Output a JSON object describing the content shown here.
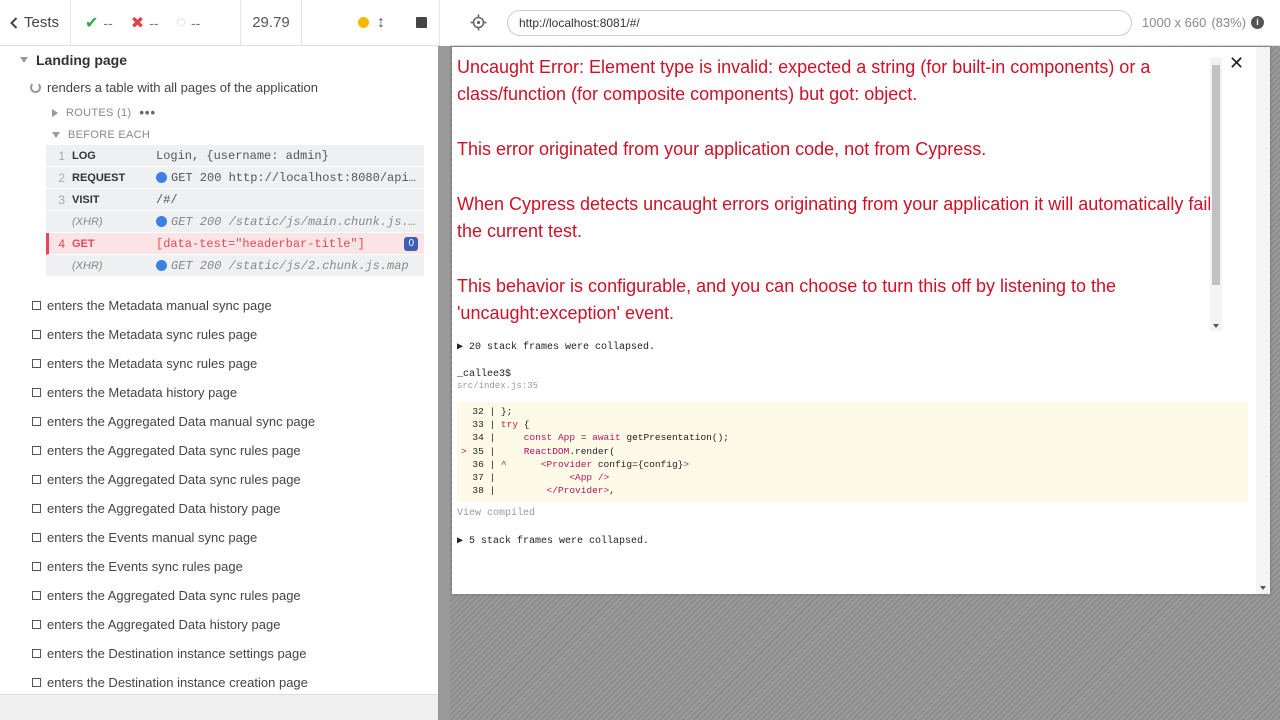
{
  "header": {
    "tests_label": "Tests",
    "passed": "--",
    "failed": "--",
    "pending": "--",
    "duration": "29.79"
  },
  "suite": {
    "title": "Landing page",
    "active_test": "renders a table with all pages of the application",
    "routes_label": "ROUTES (1)",
    "routes_more": "•••",
    "before_each_label": "BEFORE EACH",
    "commands": [
      {
        "num": "1",
        "name": "LOG",
        "msg": "Login, {username: admin}",
        "type": "normal",
        "dot": false
      },
      {
        "num": "2",
        "name": "REQUEST",
        "msg": "GET 200 http://localhost:8080/api...",
        "type": "normal",
        "dot": true
      },
      {
        "num": "3",
        "name": "VISIT",
        "msg": "/#/",
        "type": "normal",
        "dot": false
      },
      {
        "num": "",
        "name": "(XHR)",
        "msg": "GET 200 /static/js/main.chunk.js....",
        "type": "xhr",
        "dot": true
      },
      {
        "num": "4",
        "name": "GET",
        "msg": "[data-test=\"headerbar-title\"]",
        "type": "failed",
        "dot": false,
        "badge": "0"
      },
      {
        "num": "",
        "name": "(XHR)",
        "msg": "GET 200 /static/js/2.chunk.js.map",
        "type": "xhr",
        "dot": true
      }
    ],
    "pending_tests": [
      "enters the Metadata manual sync page",
      "enters the Metadata sync rules page",
      "enters the Metadata sync rules page",
      "enters the Metadata history page",
      "enters the Aggregated Data manual sync page",
      "enters the Aggregated Data sync rules page",
      "enters the Aggregated Data sync rules page",
      "enters the Aggregated Data history page",
      "enters the Events manual sync page",
      "enters the Events sync rules page",
      "enters the Aggregated Data sync rules page",
      "enters the Aggregated Data history page",
      "enters the Destination instance settings page",
      "enters the Destination instance creation page"
    ]
  },
  "aut": {
    "url": "http://localhost:8081/#/",
    "viewport": "1000 x 660",
    "scale": "(83%)"
  },
  "error_overlay": {
    "paragraphs": [
      "Uncaught Error: Element type is invalid: expected a string (for built-in components) or a class/function (for composite components) but got: object.",
      "This error originated from your application code, not from Cypress.",
      "When Cypress detects uncaught errors originating from your application it will automatically fail the current test.",
      "This behavior is configurable, and you can choose to turn this off by listening to the 'uncaught:exception' event."
    ],
    "collapsed_1": "▶ 20 stack frames were collapsed.",
    "frame_fn": "_callee3$",
    "frame_file": "src/index.js:35",
    "view_compiled": "View compiled",
    "collapsed_2": "▶ 5 stack frames were collapsed."
  },
  "colors": {
    "error_red": "#ce1126",
    "pass_green": "#2fa84f",
    "fail_red": "#e04545",
    "running_yellow": "#f5b800",
    "xhr_blue": "#3b82e0",
    "code_bg": "#fdfae8"
  }
}
